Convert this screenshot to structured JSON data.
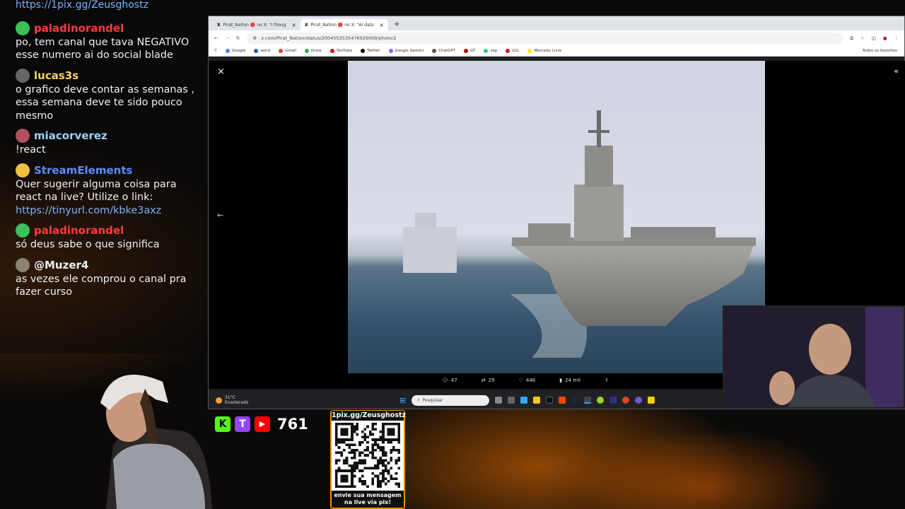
{
  "chat": {
    "top_link": "https://1pix.gg/Zeusghostz",
    "messages": [
      {
        "user": "paladinorandel",
        "color": "#ff3b3b",
        "avatar": "#3cc15a",
        "text": "po, tem canal que tava NEGATIVO esse numero ai do social blade"
      },
      {
        "user": "lucas3s",
        "color": "#f5d06a",
        "avatar": "#666666",
        "text": "o grafico deve contar as semanas , essa semana deve te sido pouco mesmo"
      },
      {
        "user": "miacorverez",
        "color": "#9bd3f0",
        "avatar": "#b05060",
        "text": "!react"
      },
      {
        "user": "StreamElements",
        "color": "#5a8cff",
        "avatar": "#f0c040",
        "text": "Quer sugerir alguma coisa para react na live? Utilize o link:",
        "link": "https://tinyurl.com/kbke3axz"
      },
      {
        "user": "paladinorandel",
        "color": "#ff3b3b",
        "avatar": "#3cc15a",
        "text": "só deus sabe o que significa"
      },
      {
        "user": "@Muzer4",
        "color": "#eeeeee",
        "avatar": "#8a8470",
        "text": "as vezes ele comprou o canal pra fazer curso"
      }
    ]
  },
  "browser": {
    "tabs": [
      {
        "label": "Pirat_Nation 🔴 no X: \"I thoug",
        "active": false
      },
      {
        "label": "Pirat_Nation 🔴 no X: \"AI data",
        "active": true
      }
    ],
    "new_tab": "+",
    "url": "x.com/Pirat_Nation/status/2004553535476929009/photo/2",
    "bookmarks": [
      {
        "label": "Google",
        "color": "#4285f4"
      },
      {
        "label": "word",
        "color": "#2b579a"
      },
      {
        "label": "Gmail",
        "color": "#ea4335"
      },
      {
        "label": "Drive",
        "color": "#34a853"
      },
      {
        "label": "YouTube",
        "color": "#ff0000"
      },
      {
        "label": "Twitter",
        "color": "#111111"
      },
      {
        "label": "Google Gemini",
        "color": "#7b6cf6"
      },
      {
        "label": "ChatGPT",
        "color": "#555555"
      },
      {
        "label": "GT",
        "color": "#c00000"
      },
      {
        "label": "zap",
        "color": "#25d366"
      },
      {
        "label": "LOL",
        "color": "#c8102e"
      },
      {
        "label": "Mercado Livre",
        "color": "#ffe600"
      }
    ],
    "all_bookmarks": "Todos os favoritos"
  },
  "post_stats": {
    "replies": "47",
    "reposts": "29",
    "likes": "446",
    "views": "24 mil"
  },
  "taskbar": {
    "temp": "31°C",
    "weather": "Ensolarado",
    "search_placeholder": "Pesquisar"
  },
  "stream": {
    "viewer_count": "761",
    "pix_url": "1pix.gg/Zeusghostz",
    "pix_caption_1": "envie sua mensagem",
    "pix_caption_2": "na live via pix!",
    "social": {
      "kick": "K",
      "twitch": "T",
      "youtube": "▶"
    }
  },
  "icons": [
    "close-icon",
    "back-arrow-icon",
    "collapse-icon",
    "reply-icon",
    "repost-icon",
    "like-icon",
    "views-icon",
    "share-icon",
    "windows-icon",
    "search-icon"
  ]
}
